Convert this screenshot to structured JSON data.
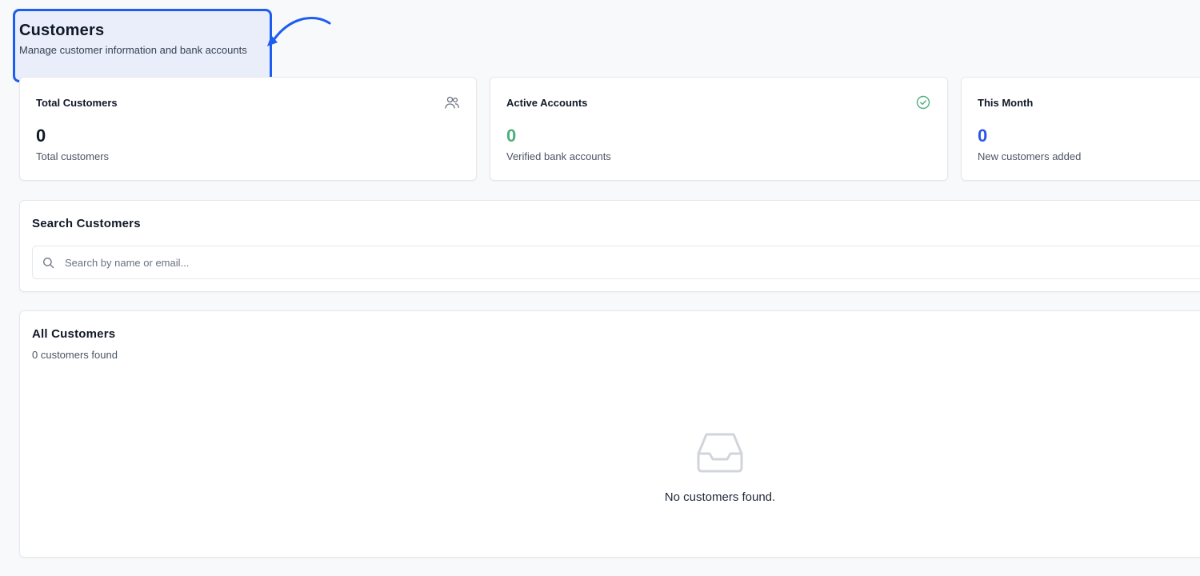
{
  "header": {
    "title": "Customers",
    "subtitle": "Manage customer information and bank accounts"
  },
  "stats": [
    {
      "title": "Total Customers",
      "value": "0",
      "description": "Total customers",
      "icon": "users-icon",
      "value_color": "#111827"
    },
    {
      "title": "Active Accounts",
      "value": "0",
      "description": "Verified bank accounts",
      "icon": "check-circle-icon",
      "value_color": "#4caf7d"
    },
    {
      "title": "This Month",
      "value": "0",
      "description": "New customers added",
      "icon": "calendar-icon",
      "value_color": "#2f54eb"
    }
  ],
  "search": {
    "title": "Search Customers",
    "placeholder": "Search by name or email...",
    "value": ""
  },
  "customers": {
    "title": "All Customers",
    "count_text": "0 customers found",
    "empty_text": "No customers found."
  },
  "colors": {
    "highlight": "#1d5ef0",
    "success": "#4caf7d",
    "accent": "#2f54eb"
  }
}
